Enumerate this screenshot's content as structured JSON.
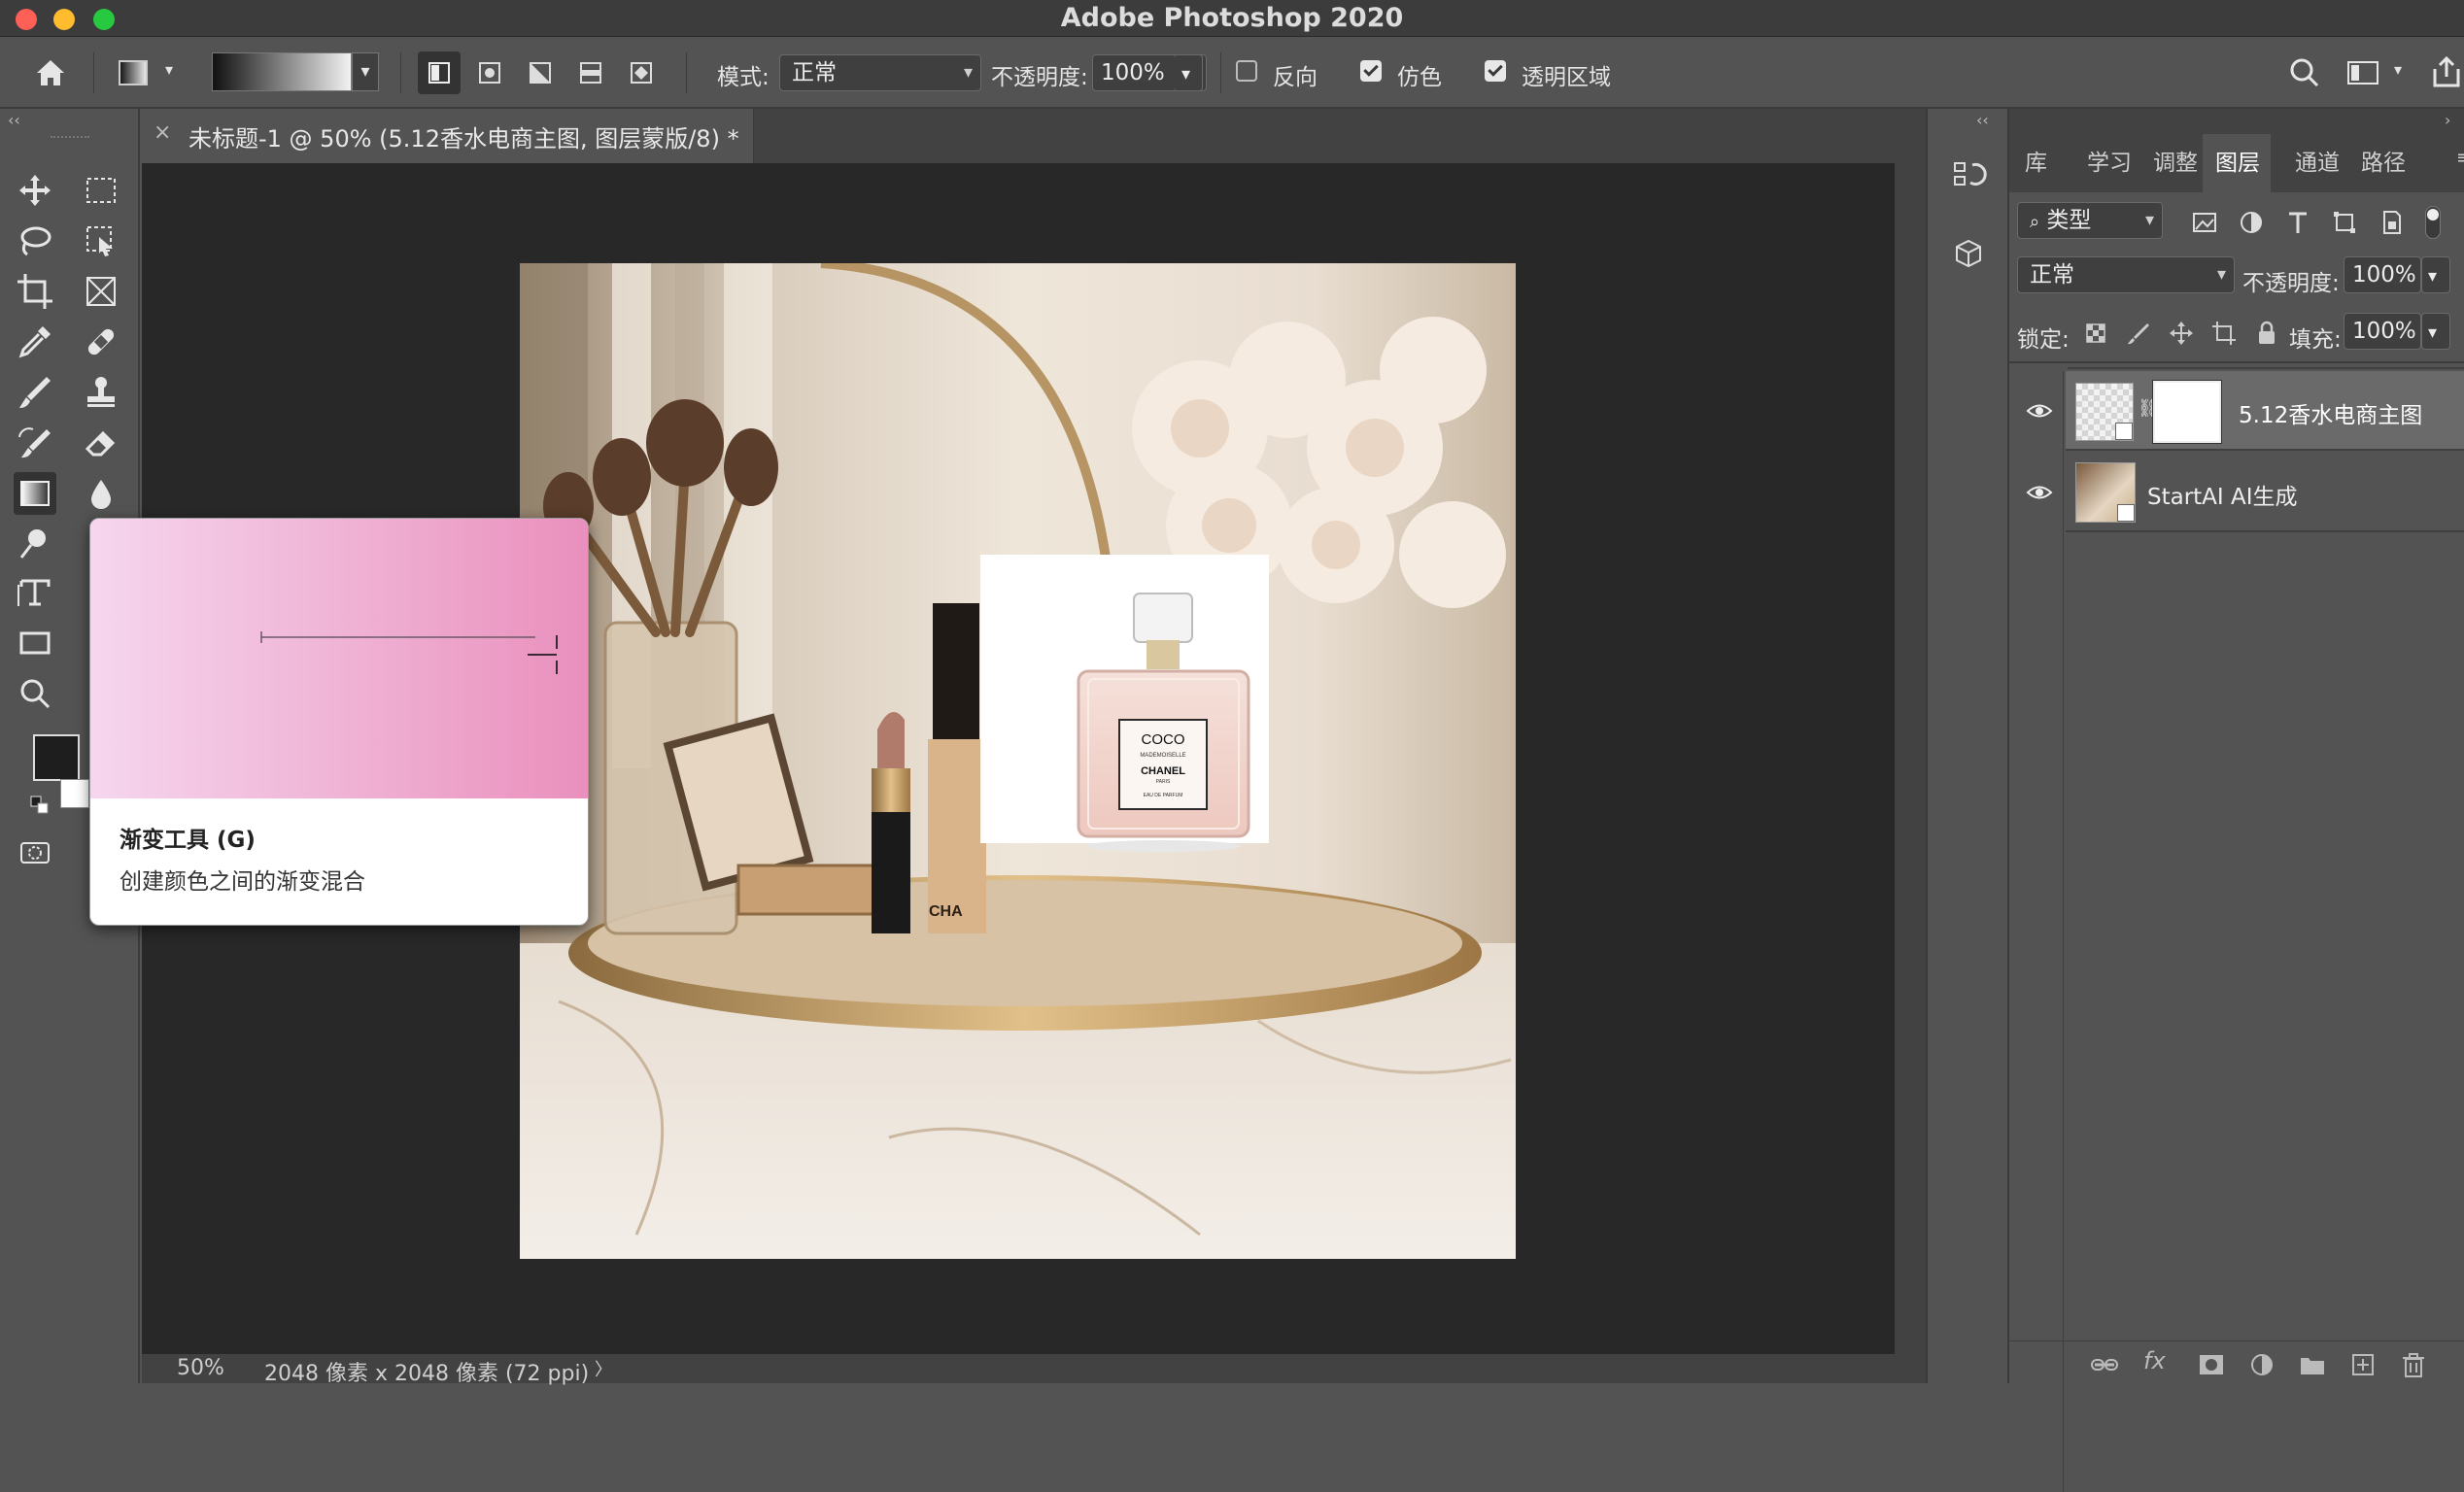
{
  "app": {
    "title": "Adobe Photoshop 2020"
  },
  "options_bar": {
    "mode_label": "模式:",
    "mode_value": "正常",
    "opacity_label": "不透明度:",
    "opacity_value": "100%",
    "reverse_label": "反向",
    "reverse_checked": false,
    "dither_label": "仿色",
    "dither_checked": true,
    "transparency_label": "透明区域",
    "transparency_checked": true
  },
  "document": {
    "tab_title": "未标题-1 @ 50% (5.12香水电商主图, 图层蒙版/8) *",
    "close_glyph": "×",
    "zoom": "50%",
    "dimensions": "2048 像素 x 2048 像素 (72 ppi)",
    "status_chevron": "〉"
  },
  "tooltip": {
    "title": "渐变工具 (G)",
    "description": "创建颜色之间的渐变混合"
  },
  "canvas_product": {
    "brand_line1": "COCO",
    "brand_line2": "MADEMOISELLE",
    "brand_line3": "CHANEL",
    "brand_line4": "PARIS",
    "brand_line5": "EAU DE PARFUM",
    "cha_text": "CHA"
  },
  "panels": {
    "tabs": [
      "库",
      "学习",
      "调整",
      "图层",
      "通道",
      "路径"
    ],
    "active_tab": "图层",
    "filter_label": "类型",
    "blend_mode": "正常",
    "opacity_label": "不透明度:",
    "opacity_value": "100%",
    "lock_label": "锁定:",
    "fill_label": "填充:",
    "fill_value": "100%",
    "menu_glyph": "≡",
    "collapse_glyph": "‹‹"
  },
  "layers": [
    {
      "name": "5.12香水电商主图",
      "visible": true,
      "has_mask": true
    },
    {
      "name": "StartAI AI生成",
      "visible": true,
      "has_mask": false
    }
  ],
  "colors": {
    "close_light": "#fe5f57",
    "minimize_light": "#febc2e",
    "zoom_light": "#28c840",
    "foreground": "#1e1e1e",
    "background": "#ffffff"
  }
}
